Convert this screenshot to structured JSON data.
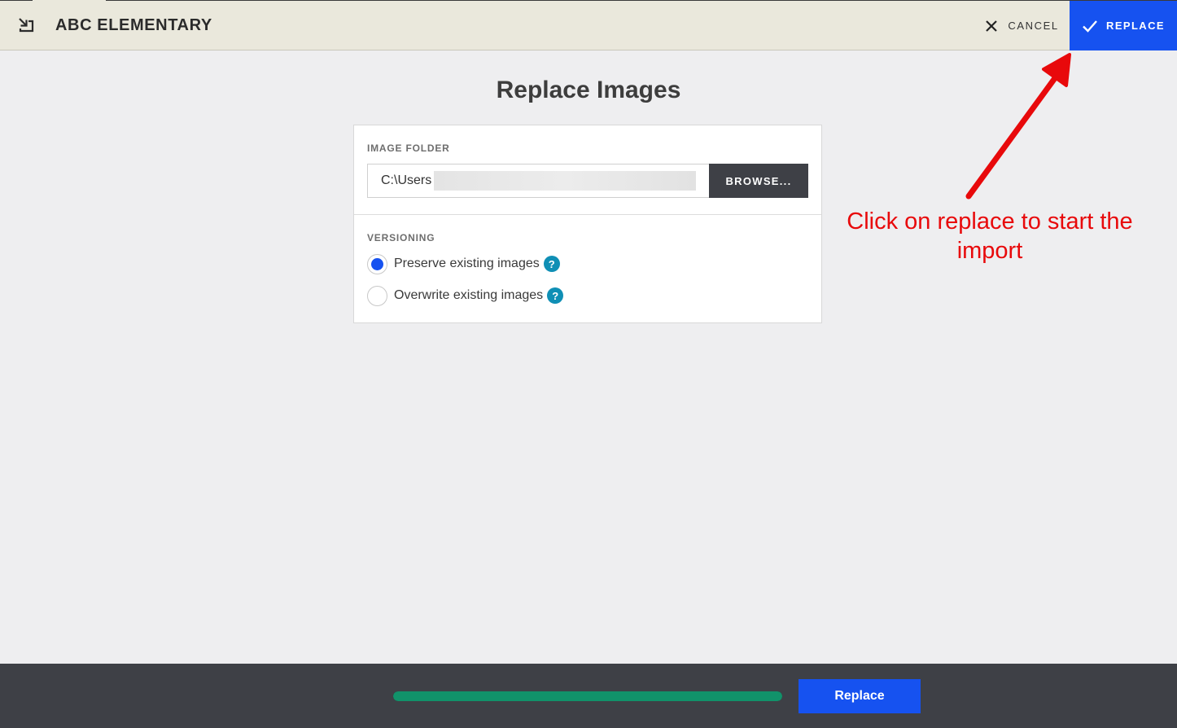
{
  "header": {
    "app_title": "ABC ELEMENTARY",
    "cancel_label": "CANCEL",
    "replace_label": "REPLACE"
  },
  "page": {
    "title": "Replace Images"
  },
  "image_folder": {
    "label": "IMAGE FOLDER",
    "value": "C:\\Users",
    "browse_label": "BROWSE..."
  },
  "versioning": {
    "label": "VERSIONING",
    "options": [
      {
        "label": "Preserve existing images",
        "checked": true
      },
      {
        "label": "Overwrite existing images",
        "checked": false
      }
    ],
    "help_glyph": "?"
  },
  "annotation": {
    "text": "Click on replace to start the import",
    "color": "#e8090b"
  },
  "footer": {
    "progress_percent": 100,
    "replace_label": "Replace"
  },
  "colors": {
    "accent": "#1652f0",
    "progress": "#11926a",
    "help": "#0f8fb5",
    "header_bg": "#eae8dc",
    "footer_bg": "#3e4046"
  },
  "icons": [
    "import-icon",
    "close-icon",
    "check-icon",
    "help-icon",
    "annotation-arrow"
  ]
}
